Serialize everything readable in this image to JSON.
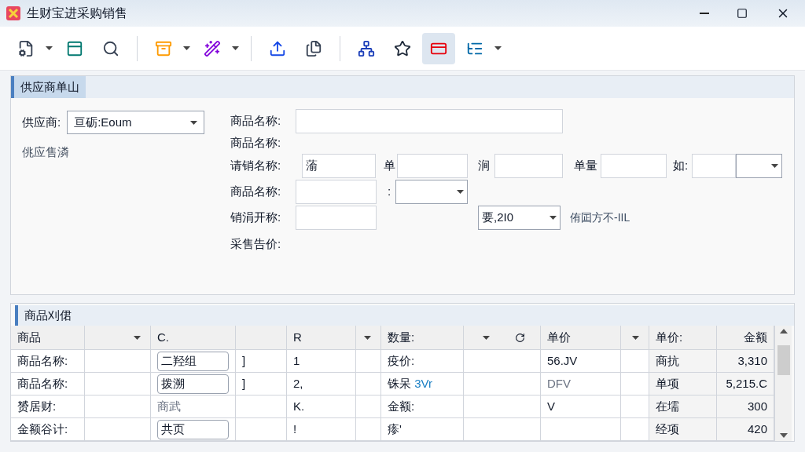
{
  "window": {
    "title": "生财宝进采购销售"
  },
  "toolbar": [
    {
      "kind": "button",
      "selected": false,
      "menu": true
    },
    {
      "kind": "button",
      "selected": false,
      "menu": false
    },
    {
      "kind": "button",
      "selected": false,
      "menu": false
    },
    {
      "kind": "separator"
    },
    {
      "kind": "button",
      "selected": false,
      "menu": true
    },
    {
      "kind": "button",
      "selected": false,
      "menu": true
    },
    {
      "kind": "separator"
    },
    {
      "kind": "button",
      "selected": false,
      "menu": false
    },
    {
      "kind": "button",
      "selected": false,
      "menu": false
    },
    {
      "kind": "separator"
    },
    {
      "kind": "button",
      "selected": false,
      "menu": false
    },
    {
      "kind": "button",
      "selected": false,
      "menu": false
    },
    {
      "kind": "button",
      "selected": true,
      "menu": false
    },
    {
      "kind": "button",
      "selected": false,
      "menu": true
    }
  ],
  "supplier_section": {
    "title": "供应商单山",
    "supplier": {
      "label": "供应商:",
      "value": "亘砺:Eoum"
    },
    "note": "佻应售潾",
    "form_rows": [
      [
        {
          "kind": "label",
          "text": "商品名称:"
        },
        {
          "kind": "input"
        }
      ],
      [
        {
          "kind": "label",
          "text": "商品名称:"
        }
      ],
      [
        {
          "kind": "label",
          "text": "请销名称:"
        },
        {
          "kind": "input",
          "value": "蕍"
        },
        {
          "kind": "label",
          "text": "单"
        },
        {
          "kind": "input"
        },
        {
          "kind": "label",
          "text": "涧"
        },
        {
          "kind": "input"
        },
        {
          "kind": "label",
          "text": "单量"
        },
        {
          "kind": "input"
        },
        {
          "kind": "label",
          "text": "如:"
        },
        {
          "kind": "input"
        },
        {
          "kind": "select"
        }
      ],
      [
        {
          "kind": "label",
          "text": "商品名称:"
        },
        {
          "kind": "input"
        },
        {
          "kind": "label",
          "text": ":"
        },
        {
          "kind": "select"
        }
      ],
      [
        {
          "kind": "label",
          "text": "销涓开称:"
        },
        {
          "kind": "input"
        },
        {
          "kind": "select",
          "value": "要,2I0"
        },
        {
          "kind": "note",
          "text": "侑囸方不-IIL"
        }
      ],
      [
        {
          "kind": "label",
          "text": "采售告价:"
        }
      ]
    ]
  },
  "list_section": {
    "title": "商品刈侰",
    "table": {
      "columns": [
        {
          "kind": "text",
          "label": "商品"
        },
        {
          "kind": "dropdown"
        },
        {
          "kind": "text",
          "label": "C."
        },
        {
          "kind": "empty"
        },
        {
          "kind": "text",
          "label": "R"
        },
        {
          "kind": "dropdown"
        },
        {
          "kind": "text",
          "label": "数量:"
        },
        {
          "kind": "dropdown-refresh"
        },
        {
          "kind": "text",
          "label": "单价"
        },
        {
          "kind": "dropdown"
        },
        {
          "kind": "text",
          "label": "单价:"
        },
        {
          "kind": "number",
          "label": "金额"
        }
      ],
      "rows": [
        [
          {
            "kind": "text",
            "text": "商品名称:"
          },
          {
            "kind": "empty"
          },
          {
            "kind": "input",
            "text": "二羟组"
          },
          {
            "kind": "text",
            "text": "]"
          },
          {
            "kind": "text",
            "text": "1"
          },
          {
            "kind": "empty"
          },
          {
            "kind": "text",
            "text": "疫价:"
          },
          {
            "kind": "empty"
          },
          {
            "kind": "text",
            "text": "56.JV"
          },
          {
            "kind": "empty"
          },
          {
            "kind": "text",
            "text": "商抗"
          },
          {
            "kind": "number",
            "text": "3,310"
          }
        ],
        [
          {
            "kind": "text",
            "text": "商品名称:"
          },
          {
            "kind": "empty"
          },
          {
            "kind": "input",
            "text": "拨溯"
          },
          {
            "kind": "text",
            "text": "]"
          },
          {
            "kind": "text",
            "text": "2,"
          },
          {
            "kind": "empty"
          },
          {
            "kind": "text",
            "text": "铢呆",
            "link": "3Vr"
          },
          {
            "kind": "empty"
          },
          {
            "kind": "muted",
            "text": "DFV"
          },
          {
            "kind": "empty"
          },
          {
            "kind": "text",
            "text": "单项"
          },
          {
            "kind": "number",
            "text": "5,215.C"
          }
        ],
        [
          {
            "kind": "text",
            "text": "赟居财:"
          },
          {
            "kind": "empty"
          },
          {
            "kind": "muted",
            "text": "商武"
          },
          {
            "kind": "empty"
          },
          {
            "kind": "text",
            "text": "K."
          },
          {
            "kind": "empty"
          },
          {
            "kind": "text",
            "text": "金额:"
          },
          {
            "kind": "empty"
          },
          {
            "kind": "text",
            "text": "V"
          },
          {
            "kind": "empty"
          },
          {
            "kind": "text",
            "text": "在壖"
          },
          {
            "kind": "number",
            "text": "300"
          }
        ],
        [
          {
            "kind": "text",
            "text": "金额谷计:"
          },
          {
            "kind": "empty"
          },
          {
            "kind": "input",
            "text": "共页"
          },
          {
            "kind": "empty"
          },
          {
            "kind": "text",
            "text": "!"
          },
          {
            "kind": "empty"
          },
          {
            "kind": "text",
            "text": "瘆'"
          },
          {
            "kind": "empty"
          },
          {
            "kind": "empty"
          },
          {
            "kind": "empty"
          },
          {
            "kind": "text",
            "text": "经项"
          },
          {
            "kind": "number",
            "text": "420"
          }
        ]
      ]
    }
  }
}
